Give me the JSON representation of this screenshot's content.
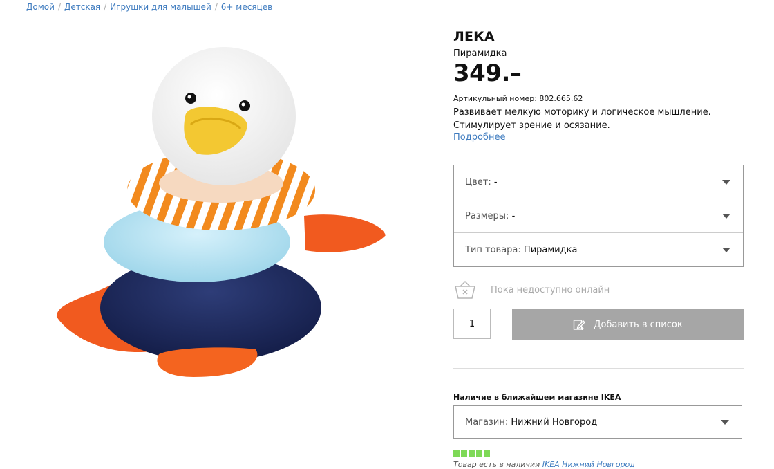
{
  "breadcrumb": {
    "items": [
      "Домой",
      "Детская",
      "Игрушки для малышей",
      "6+ месяцев"
    ],
    "separator": "/"
  },
  "product": {
    "name": "ЛЕКА",
    "type": "Пирамидка",
    "price": "349.–",
    "article": "Артикульный номер: 802.665.62",
    "description_line1": "Развивает мелкую моторику и логическое мышление.",
    "description_line2": "Стимулирует зрение и осязание.",
    "more_link": "Подробнее"
  },
  "options": {
    "color_label": "Цвет:",
    "color_value": "-",
    "size_label": "Размеры:",
    "size_value": "-",
    "type_label": "Тип товара:",
    "type_value": "Пирамидка"
  },
  "online": {
    "status": "Пока недоступно онлайн",
    "icon": "basket-unavailable-icon"
  },
  "cart": {
    "quantity": "1",
    "add_label": "Добавить в список",
    "add_icon": "edit-list-icon",
    "button_color": "#a6a6a6"
  },
  "store": {
    "heading": "Наличие в ближайшем магазине IKEA",
    "label": "Магазин:",
    "value": "Нижний Новгород",
    "stock_level": 5,
    "stock_max": 5,
    "stock_color": "#7ed957",
    "stock_prefix": "Товар есть в наличии",
    "stock_link": "IKEA Нижний Новгород"
  },
  "colors": {
    "link": "#3e7bbf",
    "text": "#111111",
    "muted": "#aaaaaa"
  }
}
